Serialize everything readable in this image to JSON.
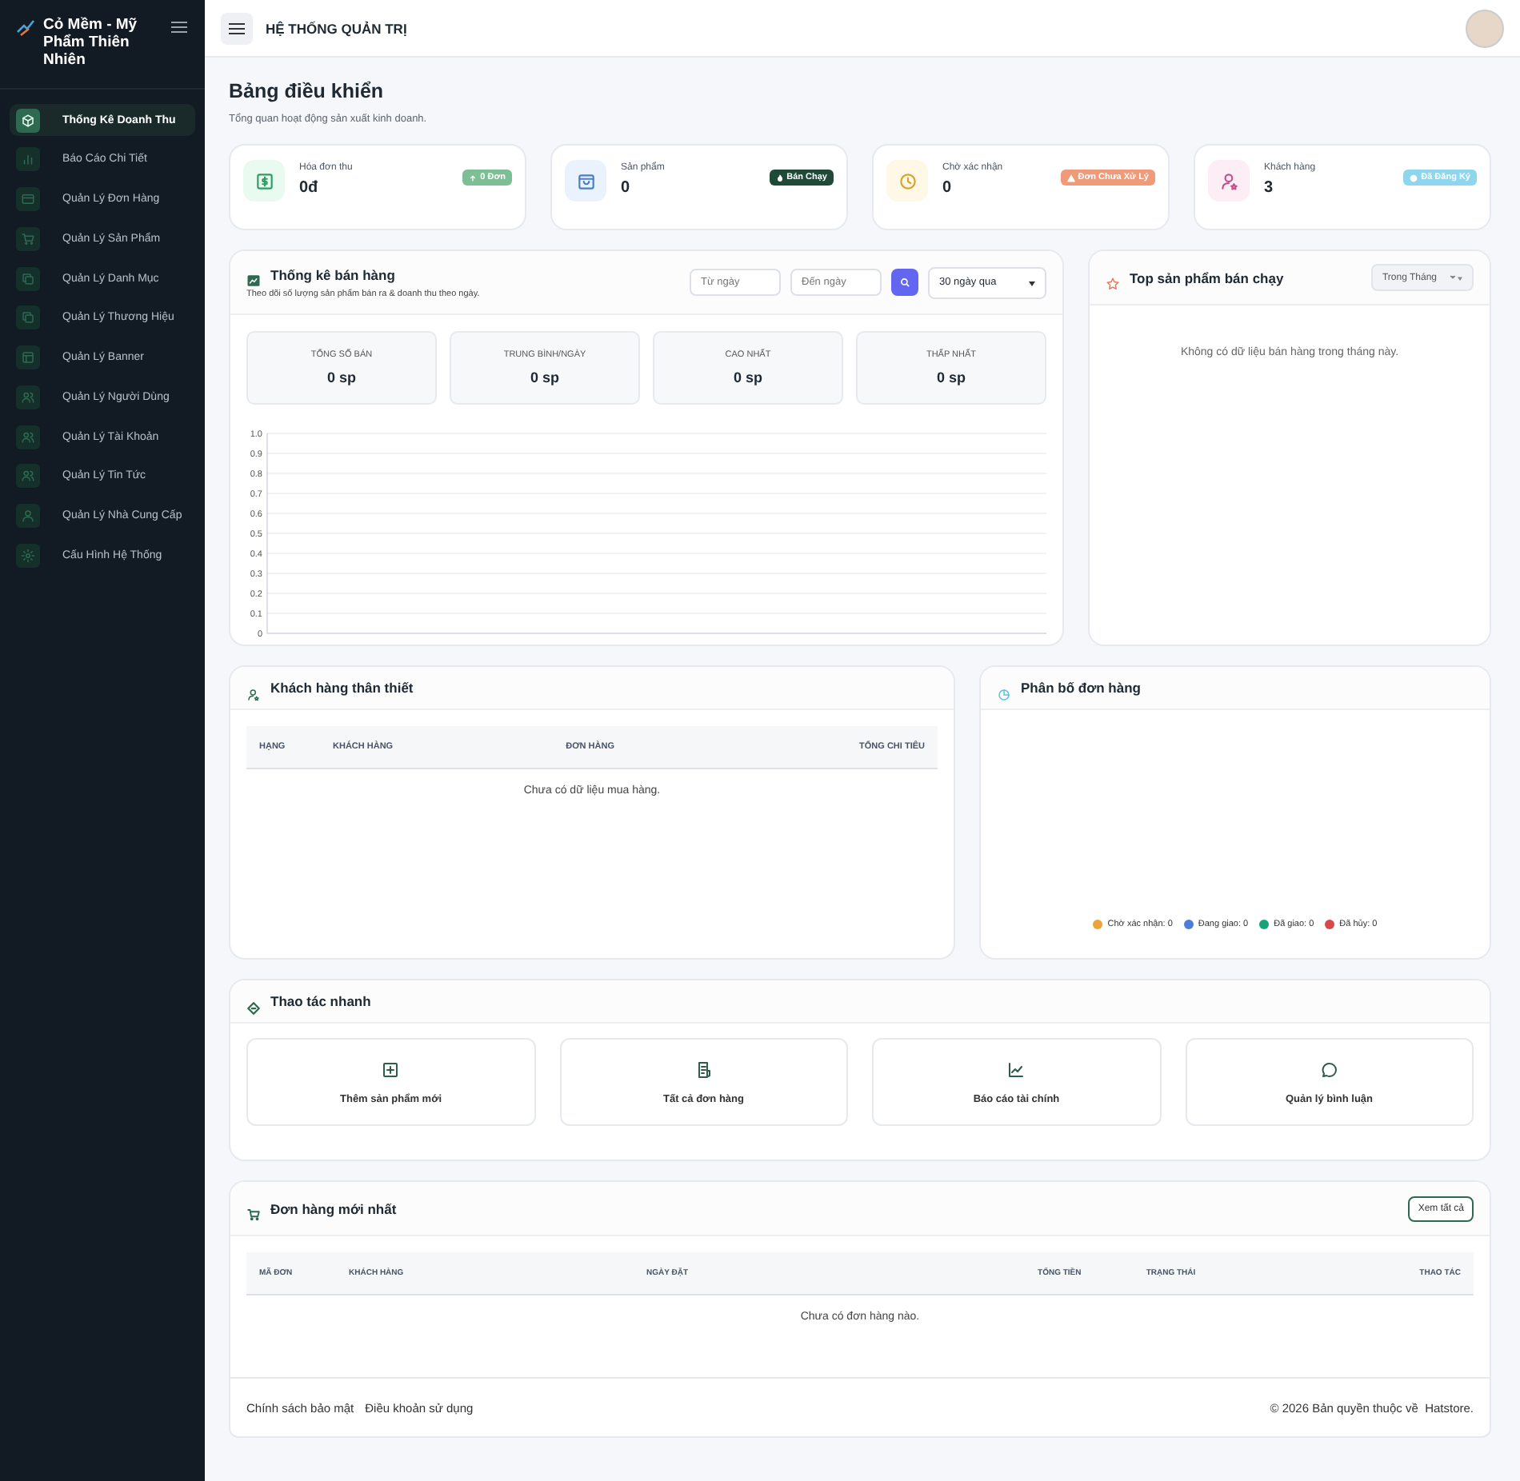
{
  "sidebar": {
    "brand": "Cỏ Mềm - Mỹ Phẩm Thiên Nhiên",
    "items": [
      {
        "label": "Thống Kê Doanh Thu",
        "selected": true
      },
      {
        "label": "Báo Cáo Chi Tiết",
        "selected": false
      },
      {
        "label": "Quản Lý Đơn Hàng",
        "selected": false
      },
      {
        "label": "Quản Lý Sản Phẩm",
        "selected": false
      },
      {
        "label": "Quản Lý Danh Mục",
        "selected": false
      },
      {
        "label": "Quản Lý Thương Hiệu",
        "selected": false
      },
      {
        "label": "Quản Lý Banner",
        "selected": false
      },
      {
        "label": "Quản Lý Người Dùng",
        "selected": false
      },
      {
        "label": "Quản Lý Tài Khoản",
        "selected": false
      },
      {
        "label": "Quản Lý Tin Tức",
        "selected": false
      },
      {
        "label": "Quản Lý Nhà Cung Cấp",
        "selected": false
      },
      {
        "label": "Cấu Hình Hệ Thống",
        "selected": false
      }
    ]
  },
  "topbar": {
    "title": "HỆ THỐNG QUẢN TRỊ"
  },
  "page": {
    "title": "Bảng điều khiển",
    "subtitle": "Tổng quan hoạt động sản xuất kinh doanh."
  },
  "stats": [
    {
      "label": "Hóa đơn thu",
      "value": "0đ",
      "badge": "0 Đơn",
      "color": "#7cbf95"
    },
    {
      "label": "Sản phẩm",
      "value": "0",
      "badge": "Bán Chạy",
      "color": "#1f4a38"
    },
    {
      "label": "Chờ xác nhận",
      "value": "0",
      "badge": "Đơn Chưa Xử Lý",
      "color": "#ef9a78"
    },
    {
      "label": "Khách hàng",
      "value": "3",
      "badge": "Đã Đăng Ký",
      "color": "#8dd6ee"
    }
  ],
  "sales": {
    "title": "Thống kê bán hàng",
    "subtitle": "Theo dõi số lượng sản phẩm bán ra & doanh thu theo ngày.",
    "from": {
      "placeholder": "Từ ngày"
    },
    "to": {
      "placeholder": "Đến ngày"
    },
    "range": "30 ngày qua",
    "summary": [
      {
        "label": "TỔNG SỐ BÁN",
        "value": "0 sp"
      },
      {
        "label": "TRUNG BÌNH/NGÀY",
        "value": "0 sp"
      },
      {
        "label": "CAO NHẤT",
        "value": "0 sp"
      },
      {
        "label": "THẤP NHẤT",
        "value": "0 sp"
      }
    ],
    "axis_labels": [
      "1.0",
      "0.9",
      "0.8",
      "0.7",
      "0.6",
      "0.5",
      "0.4",
      "0.3",
      "0.2",
      "0.1",
      "0"
    ]
  },
  "top_products": {
    "title": "Top sản phẩm bán chạy",
    "filter": "Trong Tháng",
    "empty": "Không có dữ liệu bán hàng trong tháng này."
  },
  "customers": {
    "title": "Khách hàng thân thiết",
    "columns": [
      "HẠNG",
      "KHÁCH HÀNG",
      "ĐƠN HÀNG",
      "TỔNG CHI TIÊU"
    ],
    "empty": "Chưa có dữ liệu mua hàng."
  },
  "distribution": {
    "title": "Phân bố đơn hàng",
    "legend": [
      {
        "label": "Chờ xác nhận: 0",
        "color": "#eea33a"
      },
      {
        "label": "Đang giao: 0",
        "color": "#4a7fd8"
      },
      {
        "label": "Đã giao: 0",
        "color": "#17a278"
      },
      {
        "label": "Đã hủy: 0",
        "color": "#d9484a"
      }
    ]
  },
  "quick_actions": {
    "title": "Thao tác nhanh",
    "actions": [
      "Thêm sản phẩm mới",
      "Tất cả đơn hàng",
      "Báo cáo tài chính",
      "Quản lý bình luận"
    ]
  },
  "recent_orders": {
    "title": "Đơn hàng mới nhất",
    "button": "Xem tất cả",
    "columns": [
      "MÃ ĐƠN",
      "KHÁCH HÀNG",
      "NGÀY ĐẶT",
      "TỔNG TIỀN",
      "TRẠNG THÁI",
      "THAO TÁC"
    ],
    "empty": "Chưa có đơn hàng nào."
  },
  "footer": {
    "links": [
      "Chính sách bảo mật",
      "Điều khoản sử dụng"
    ],
    "copyright": "© 2026 Bản quyền thuộc về  Hatstore."
  }
}
